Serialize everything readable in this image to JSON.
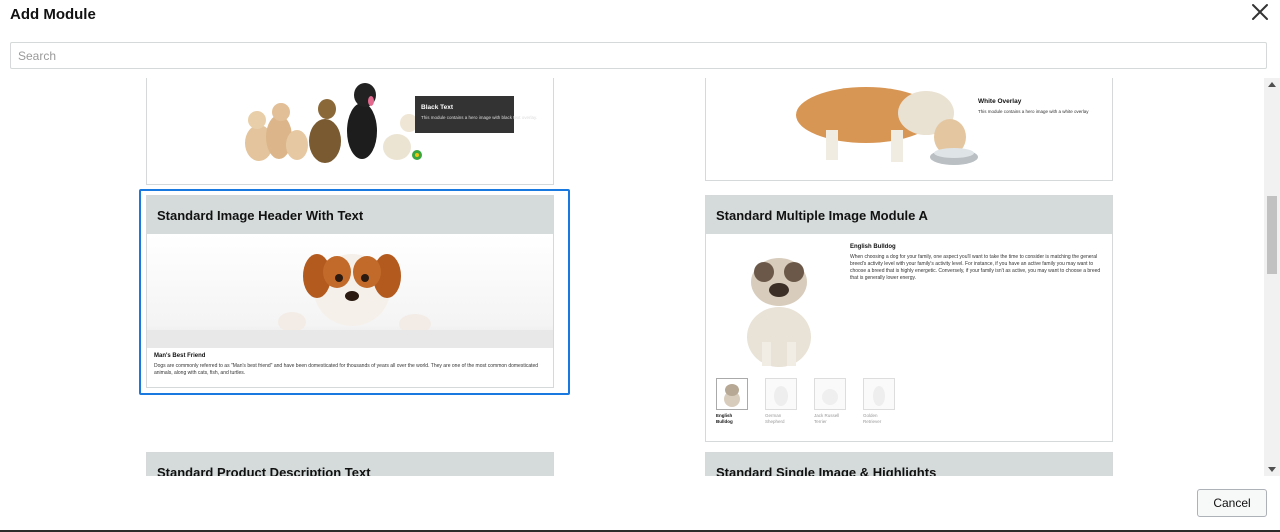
{
  "dialog": {
    "title": "Add Module",
    "close_label": "close",
    "search_placeholder": "Search",
    "cancel_label": "Cancel"
  },
  "modules": [
    {
      "overlay_title": "Black Text",
      "overlay_text": "This module contains a hero image with black text overlay."
    },
    {
      "overlay_title": "White Overlay",
      "overlay_text": "This module contains a hero image with a white overlay"
    },
    {
      "title": "Standard Image Header With Text",
      "caption_title": "Man's Best Friend",
      "caption_text": "Dogs are commonly referred to as \"Man's best friend\" and have been domesticated for thousands of years all over the world. They are one of the most common domesticated animals, along with cats, fish, and turtles.",
      "selected": true
    },
    {
      "title": "Standard Multiple Image Module A",
      "heading": "English Bulldog",
      "body": "When choosing a dog for your family, one aspect you'll want to take the time to consider is matching the general breed's activity level with your family's activity level. For instance, if you have an active family you may want to choose a breed that is highly energetic. Conversely, if your family isn't as active, you may want to choose a breed that is generally lower energy.",
      "thumbs": [
        {
          "label": "English Bulldog",
          "active": true
        },
        {
          "label": "German Shepherd",
          "active": false
        },
        {
          "label": "Jack Russell Terrier",
          "active": false
        },
        {
          "label": "Golden Retriever",
          "active": false
        }
      ]
    },
    {
      "title": "Standard Product Description Text"
    },
    {
      "title": "Standard Single Image & Highlights"
    }
  ],
  "colors": {
    "selection": "#1a79e0",
    "card_header": "#d5dbdb"
  }
}
